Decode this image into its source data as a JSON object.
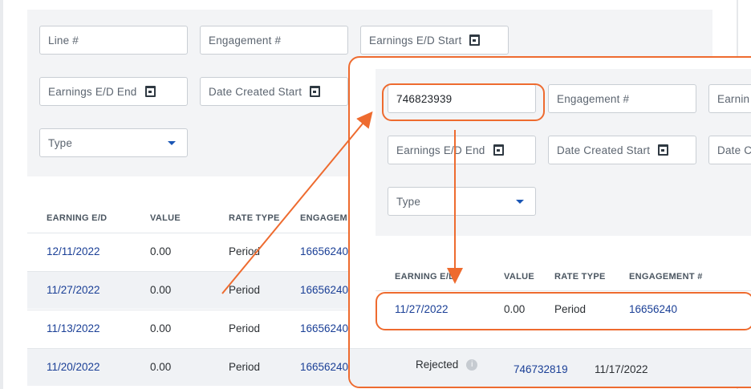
{
  "filters": {
    "line_no": "Line #",
    "engagement_no": "Engagement #",
    "earnings_start": "Earnings E/D Start",
    "earnings_end": "Earnings E/D End",
    "date_created_start": "Date Created Start",
    "type": "Type"
  },
  "table": {
    "columns": [
      "EARNING E/D",
      "VALUE",
      "RATE TYPE",
      "ENGAGEM"
    ],
    "rows": [
      {
        "earning_ed": "12/11/2022",
        "value": "0.00",
        "rate_type": "Period",
        "engagement": "16656240"
      },
      {
        "earning_ed": "11/27/2022",
        "value": "0.00",
        "rate_type": "Period",
        "engagement": "16656240"
      },
      {
        "earning_ed": "11/13/2022",
        "value": "0.00",
        "rate_type": "Period",
        "engagement": "16656240"
      },
      {
        "earning_ed": "11/20/2022",
        "value": "0.00",
        "rate_type": "Period",
        "engagement": "16656240"
      }
    ]
  },
  "zoom": {
    "line_value": "746823939",
    "engagement_no": "Engagement #",
    "earnings_cut": "Earnin",
    "earnings_end": "Earnings E/D End",
    "date_created_start": "Date Created Start",
    "date_cut": "Date C",
    "type": "Type",
    "columns": [
      "EARNING E/D",
      "VALUE",
      "RATE TYPE",
      "ENGAGEMENT #"
    ],
    "result": {
      "earning_ed": "11/27/2022",
      "value": "0.00",
      "rate_type": "Period",
      "engagement": "16656240"
    },
    "below": {
      "status": "Rejected",
      "id": "746732819",
      "date": "11/17/2022"
    }
  },
  "colors": {
    "accent": "#ee6b2f",
    "link": "#1a3f96"
  }
}
